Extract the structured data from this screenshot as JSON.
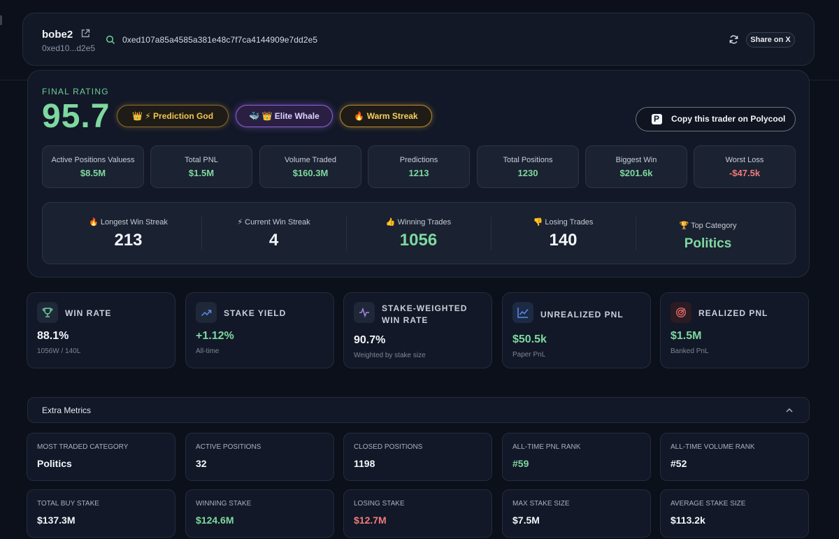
{
  "header": {
    "trader_name": "bobe2",
    "short_address": "0xed10...d2e5",
    "full_address": "0xed107a85a4585a381e48c7f7ca4144909e7dd2e5",
    "share_label": "Share on X"
  },
  "rating": {
    "label": "FINAL RATING",
    "score": "95.7",
    "badges": [
      {
        "icons": "👑 ⚡",
        "text": "Prediction God"
      },
      {
        "icons": "🐳 👑",
        "text": "Elite Whale"
      },
      {
        "icons": "🔥",
        "text": "Warm Streak"
      }
    ],
    "copy_label": "Copy this trader on Polycool",
    "stats": [
      {
        "label": "Active Positions Valuess",
        "value": "$8.5M"
      },
      {
        "label": "Total PNL",
        "value": "$1.5M"
      },
      {
        "label": "Volume Traded",
        "value": "$160.3M"
      },
      {
        "label": "Predictions",
        "value": "1213"
      },
      {
        "label": "Total Positions",
        "value": "1230"
      },
      {
        "label": "Biggest Win",
        "value": "$201.6k"
      },
      {
        "label": "Worst Loss",
        "value": "-$47.5k"
      }
    ],
    "streaks": [
      {
        "icon": "🔥",
        "label": "Longest Win Streak",
        "value": "213"
      },
      {
        "icon": "⚡",
        "label": "Current Win Streak",
        "value": "4"
      },
      {
        "icon": "👍",
        "label": "Winning Trades",
        "value": "1056"
      },
      {
        "icon": "👎",
        "label": "Losing Trades",
        "value": "140"
      },
      {
        "icon": "🏆",
        "label": "Top Category",
        "value": "Politics"
      }
    ]
  },
  "metrics": [
    {
      "icon": "trophy-icon",
      "title": "WIN RATE",
      "value": "88.1%",
      "sub": "1056W / 140L"
    },
    {
      "icon": "trend-up-icon",
      "title": "STAKE YIELD",
      "value": "+1.12%",
      "sub": "All-time"
    },
    {
      "icon": "pulse-icon",
      "title": "STAKE-WEIGHTED WIN RATE",
      "value": "90.7%",
      "sub": "Weighted by stake size"
    },
    {
      "icon": "chart-line-icon",
      "title": "UNREALIZED PNL",
      "value": "$50.5k",
      "sub": "Paper PnL"
    },
    {
      "icon": "target-icon",
      "title": "REALIZED PNL",
      "value": "$1.5M",
      "sub": "Banked PnL"
    }
  ],
  "extra": {
    "title": "Extra Metrics",
    "cards": [
      {
        "label": "MOST TRADED CATEGORY",
        "value": "Politics"
      },
      {
        "label": "ACTIVE POSITIONS",
        "value": "32"
      },
      {
        "label": "CLOSED POSITIONS",
        "value": "1198"
      },
      {
        "label": "ALL-TIME PNL RANK",
        "value": "#59"
      },
      {
        "label": "ALL-TIME VOLUME RANK",
        "value": "#52"
      },
      {
        "label": "TOTAL BUY STAKE",
        "value": "$137.3M"
      },
      {
        "label": "WINNING STAKE",
        "value": "$124.6M"
      },
      {
        "label": "LOSING STAKE",
        "value": "$12.7M"
      },
      {
        "label": "MAX STAKE SIZE",
        "value": "$7.5M"
      },
      {
        "label": "AVERAGE STAKE SIZE",
        "value": "$113.2k"
      }
    ]
  },
  "colors": {
    "background": "#0b101b",
    "card": "#121827",
    "positive": "#7ed8a0",
    "negative": "#ef7b7b",
    "gold": "#f1c64e",
    "purple": "#8f63d6"
  }
}
